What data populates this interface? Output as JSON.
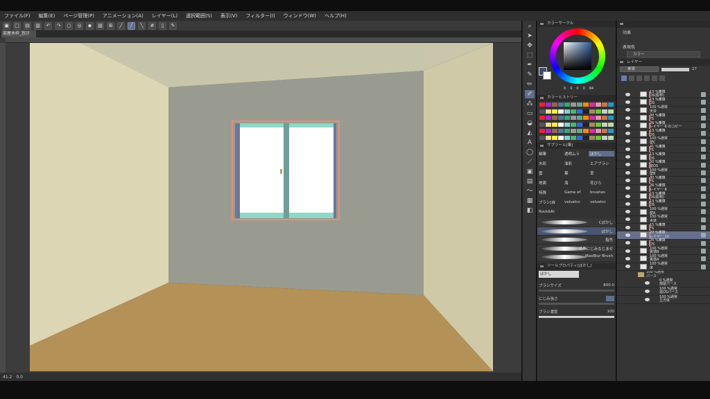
{
  "menu": [
    "ファイル(F)",
    "編集(E)",
    "ページ管理(P)",
    "アニメーション(A)",
    "レイヤー(L)",
    "選択範囲(S)",
    "表示(V)",
    "フィルター(I)",
    "ウィンドウ(W)",
    "ヘルプ(H)"
  ],
  "document_tab": "部屋木枠_窓(F",
  "status": {
    "zoom": "41.2",
    "angle": "0.0"
  },
  "panels": {
    "color_circle": "カラーサークル",
    "color_history": "カラーヒストリー",
    "subtool": "サブツール[筆]",
    "tool_property": "ツールプロパティ[ぼかし]",
    "effect": "効果",
    "display_color": "表現色",
    "display_color_value": "カラー",
    "layer": "レイヤー",
    "blend_mode": "乗算",
    "opacity": "27"
  },
  "color_readout": [
    "0",
    "0",
    "0",
    "0",
    "84"
  ],
  "subtool_tabs": [
    [
      "細筆",
      "透明ムラ",
      "ぼかし"
    ],
    [
      "水彩",
      "油彩",
      "エアブラシ"
    ],
    [
      "雲",
      "葉",
      "草"
    ],
    [
      "地面",
      "海",
      "花びら"
    ],
    [
      "特殊",
      "Game ef",
      "brushes"
    ],
    [
      "ブラシ[自",
      "velvetcc",
      "velvetcc"
    ],
    [
      "Rock&Ri",
      "",
      ""
    ]
  ],
  "brushes": [
    "Cぼかし",
    "ぼかし",
    "指先",
    "境界にじみなじませ",
    "MaxBlur Brush"
  ],
  "tool_property": {
    "name": "ぼかし",
    "brush_size_label": "ブラシサイズ",
    "brush_size_value": "800.0",
    "blur_label": "にじみ強さ",
    "density_label": "ブラシ濃度",
    "density_value": "100"
  },
  "layers": [
    {
      "mode": "13 %乗算",
      "name": "OS(影枠)",
      "clip": true
    },
    {
      "mode": "13 %乗算",
      "name": "OS",
      "clip": true
    },
    {
      "mode": "100 %通常",
      "name": "天井",
      "clip": false
    },
    {
      "mode": "30 %乗算",
      "name": "FS",
      "clip": true
    },
    {
      "mode": "26 %乗算",
      "name": "レイヤー 8 のコピー",
      "clip": true
    },
    {
      "mode": "13 %乗算",
      "name": "OS",
      "clip": true
    },
    {
      "mode": "100 %通常",
      "name": "壁C",
      "clip": false
    },
    {
      "mode": "41 %乗算",
      "name": "FS",
      "clip": true
    },
    {
      "mode": "13 %乗算",
      "name": "OS",
      "clip": true
    },
    {
      "mode": "50 %乗算",
      "name": "窓OS",
      "clip": true
    },
    {
      "mode": "100 %通常",
      "name": "壁B",
      "clip": false
    },
    {
      "mode": "30 %乗算",
      "name": "FS",
      "clip": true
    },
    {
      "mode": "26 %乗算",
      "name": "レイヤー 8",
      "clip": true
    },
    {
      "mode": "13 %乗算",
      "name": "OS(影枠)",
      "clip": true
    },
    {
      "mode": "13 %乗算",
      "name": "OS",
      "clip": true
    },
    {
      "mode": "100 %通常",
      "name": "壁A",
      "clip": false
    },
    {
      "mode": "100 %通常",
      "name": "木目",
      "clip": false
    },
    {
      "mode": "15 %乗算",
      "name": "FS",
      "clip": true
    },
    {
      "mode": "27 %乗算",
      "name": "レイヤー 10",
      "clip": true,
      "selected": true
    },
    {
      "mode": "25 %乗算",
      "name": "OS",
      "clip": true
    },
    {
      "mode": "100 %通常",
      "name": "質感B",
      "clip": false
    },
    {
      "mode": "100 %通常",
      "name": "質感A",
      "clip": false
    },
    {
      "mode": "100 %通常",
      "name": "床",
      "clip": false
    }
  ],
  "folder": {
    "mode": "100 %通常",
    "name": "パース"
  },
  "folder_layers": [
    {
      "mode": "0 %通常",
      "name": "部屋パース"
    },
    {
      "mode": "100 %通常",
      "name": "窓OSパース"
    },
    {
      "mode": "100 %通常",
      "name": "立方体"
    }
  ]
}
